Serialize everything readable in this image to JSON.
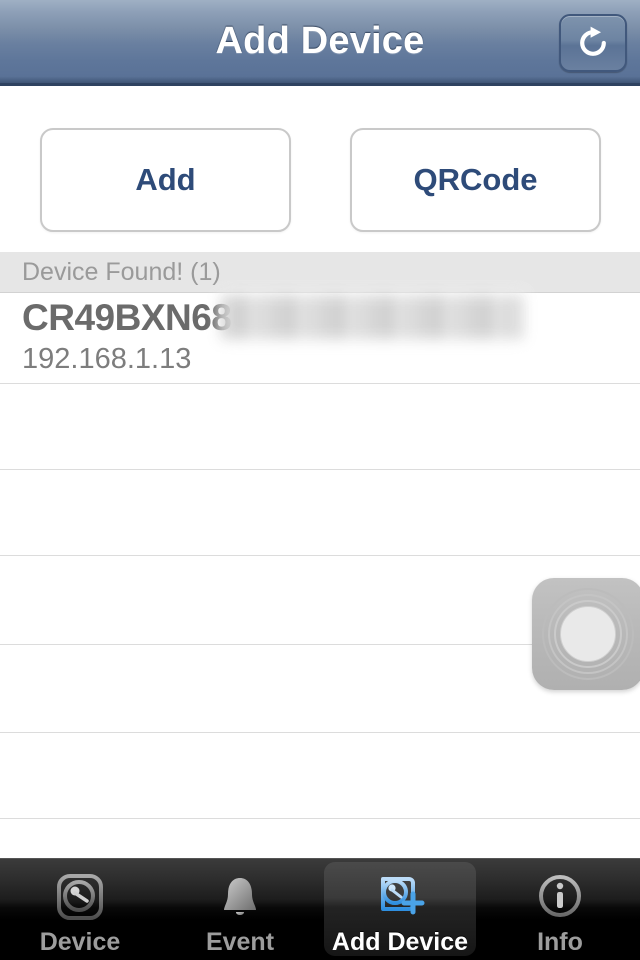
{
  "navbar": {
    "title": "Add Device",
    "refresh_icon": "refresh-icon"
  },
  "actions": {
    "add_label": "Add",
    "qrcode_label": "QRCode"
  },
  "list": {
    "section_header": "Device Found! (1)",
    "device": {
      "name": "CR49BXN68",
      "name_redacted": true,
      "ip": "192.168.1.13"
    },
    "empty_rows": 6
  },
  "scan_indicator": {
    "icon": "scan-rings-icon"
  },
  "tabbar": {
    "tabs": [
      {
        "label": "Device",
        "icon": "camera-icon",
        "active": false
      },
      {
        "label": "Event",
        "icon": "bell-icon",
        "active": false
      },
      {
        "label": "Add Device",
        "icon": "camera-plus-icon",
        "active": true
      },
      {
        "label": "Info",
        "icon": "info-circle-icon",
        "active": false
      }
    ]
  },
  "colors": {
    "nav_gradient_top": "#9fb0c4",
    "nav_gradient_bottom": "#5a7297",
    "nav_border": "#2e4260",
    "button_text": "#2e4b79",
    "section_bg": "#e6e6e6",
    "section_text": "#9a9a9a",
    "device_name_text": "#6b6b6b",
    "device_ip_text": "#7d7d7d",
    "separator": "#dcdcdc",
    "tabbar_bg": "#000000",
    "tab_label": "#9d9d9d",
    "tab_label_active": "#ffffff",
    "tab_active_icon": "#5fa8e8"
  }
}
